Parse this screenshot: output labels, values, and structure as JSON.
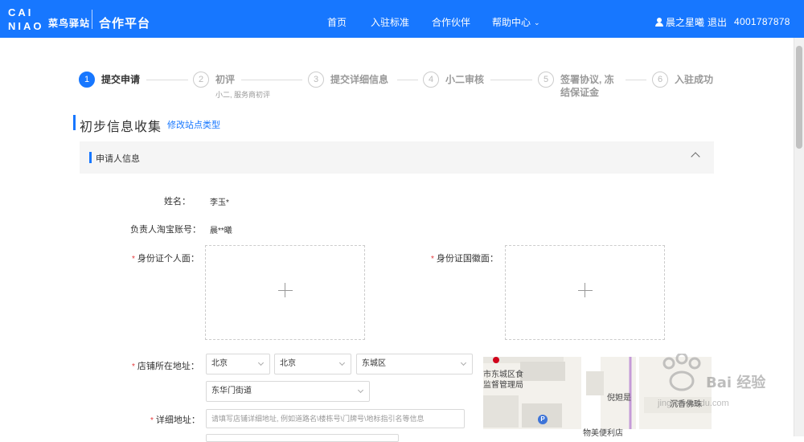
{
  "header": {
    "logo_line1": "CAI",
    "logo_line2": "NIAO",
    "logo_cn": "菜鸟驿站",
    "platform": "合作平台",
    "nav": [
      "首页",
      "入驻标准",
      "合作伙伴",
      "帮助中心"
    ],
    "user_name": "晨之星曦",
    "logout": "退出",
    "phone": "4001787878",
    "bg_color": "#1777ff"
  },
  "steps": [
    {
      "num": "1",
      "label": "提交申请",
      "sub": "",
      "state": "active"
    },
    {
      "num": "2",
      "label": "初评",
      "sub": "小二, 服务商初评",
      "state": "pending"
    },
    {
      "num": "3",
      "label": "提交详细信息",
      "sub": "",
      "state": "pending"
    },
    {
      "num": "4",
      "label": "小二审核",
      "sub": "",
      "state": "pending"
    },
    {
      "num": "5",
      "label": "签署协议, 冻",
      "label2": "结保证金",
      "sub": "",
      "state": "pending"
    },
    {
      "num": "6",
      "label": "入驻成功",
      "sub": "",
      "state": "pending"
    }
  ],
  "section": {
    "title": "初步信息收集",
    "link": "修改站点类型"
  },
  "panel": {
    "title": "申请人信息"
  },
  "form": {
    "name_label": "姓名：",
    "name_value": "李玉*",
    "taobao_label": "负责人淘宝账号：",
    "taobao_value": "晨**曦",
    "id_front_label": "身份证个人面：",
    "id_back_label": "身份证国徽面：",
    "address_label": "店铺所在地址：",
    "province": "北京",
    "city": "北京",
    "district": "东城区",
    "street": "东华门街道",
    "detail_label": "详细地址：",
    "detail_placeholder": "请填写店铺详细地址, 例如道路名\\楼栋号\\门牌号\\地标指引名等信息",
    "required_mark": "*"
  },
  "map": {
    "labels": [
      "市东城区食",
      "监督管理局",
      "倪妲是",
      "沉香佛珠",
      "物美便利店"
    ],
    "parking": "P"
  },
  "watermark": {
    "text": "Bai 经验",
    "url": "jingyan.baidu.com"
  },
  "colors": {
    "accent": "#1777ff",
    "required": "#e4393c"
  }
}
